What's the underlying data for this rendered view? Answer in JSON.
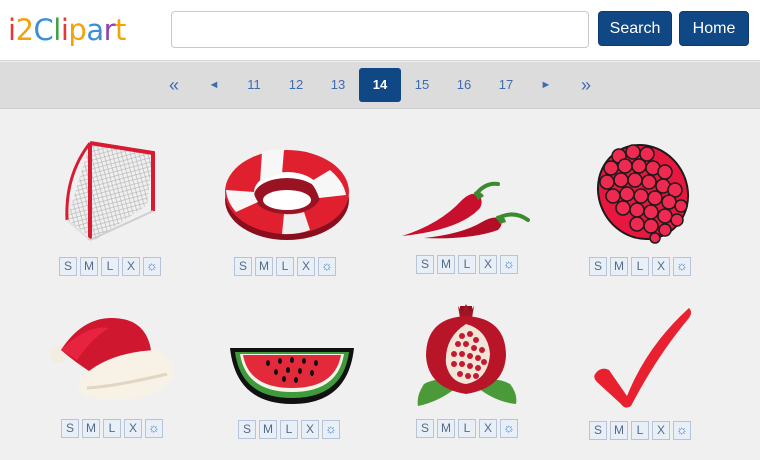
{
  "header": {
    "logo": {
      "letters": [
        "i",
        "2",
        "C",
        "l",
        "i",
        "p",
        "a",
        "r",
        "t"
      ],
      "colors": [
        "#e53935",
        "#f2a20c",
        "#3b8ed9",
        "#43a047",
        "#e53935",
        "#f2a20c",
        "#3b8ed9",
        "#8e44ad",
        "#f2a20c"
      ]
    },
    "search": {
      "value": "",
      "placeholder": "",
      "button_label": "Search"
    },
    "home_label": "Home"
  },
  "pagination": {
    "first": "«",
    "prev": "◄",
    "pages": [
      "11",
      "12",
      "13",
      "14",
      "15",
      "16",
      "17"
    ],
    "current": "14",
    "next": "►",
    "last": "»"
  },
  "size_buttons": [
    "S",
    "M",
    "L",
    "X",
    "☼"
  ],
  "grid": [
    {
      "art": "hockey-net-icon"
    },
    {
      "art": "life-ring-icon"
    },
    {
      "art": "chili-peppers-icon"
    },
    {
      "art": "raspberry-icon"
    },
    {
      "art": "santa-hat-icon"
    },
    {
      "art": "watermelon-slice-icon"
    },
    {
      "art": "pomegranate-icon"
    },
    {
      "art": "checkmark-icon"
    }
  ],
  "colors": {
    "accent": "#104785",
    "art_red": "#d81b30"
  }
}
